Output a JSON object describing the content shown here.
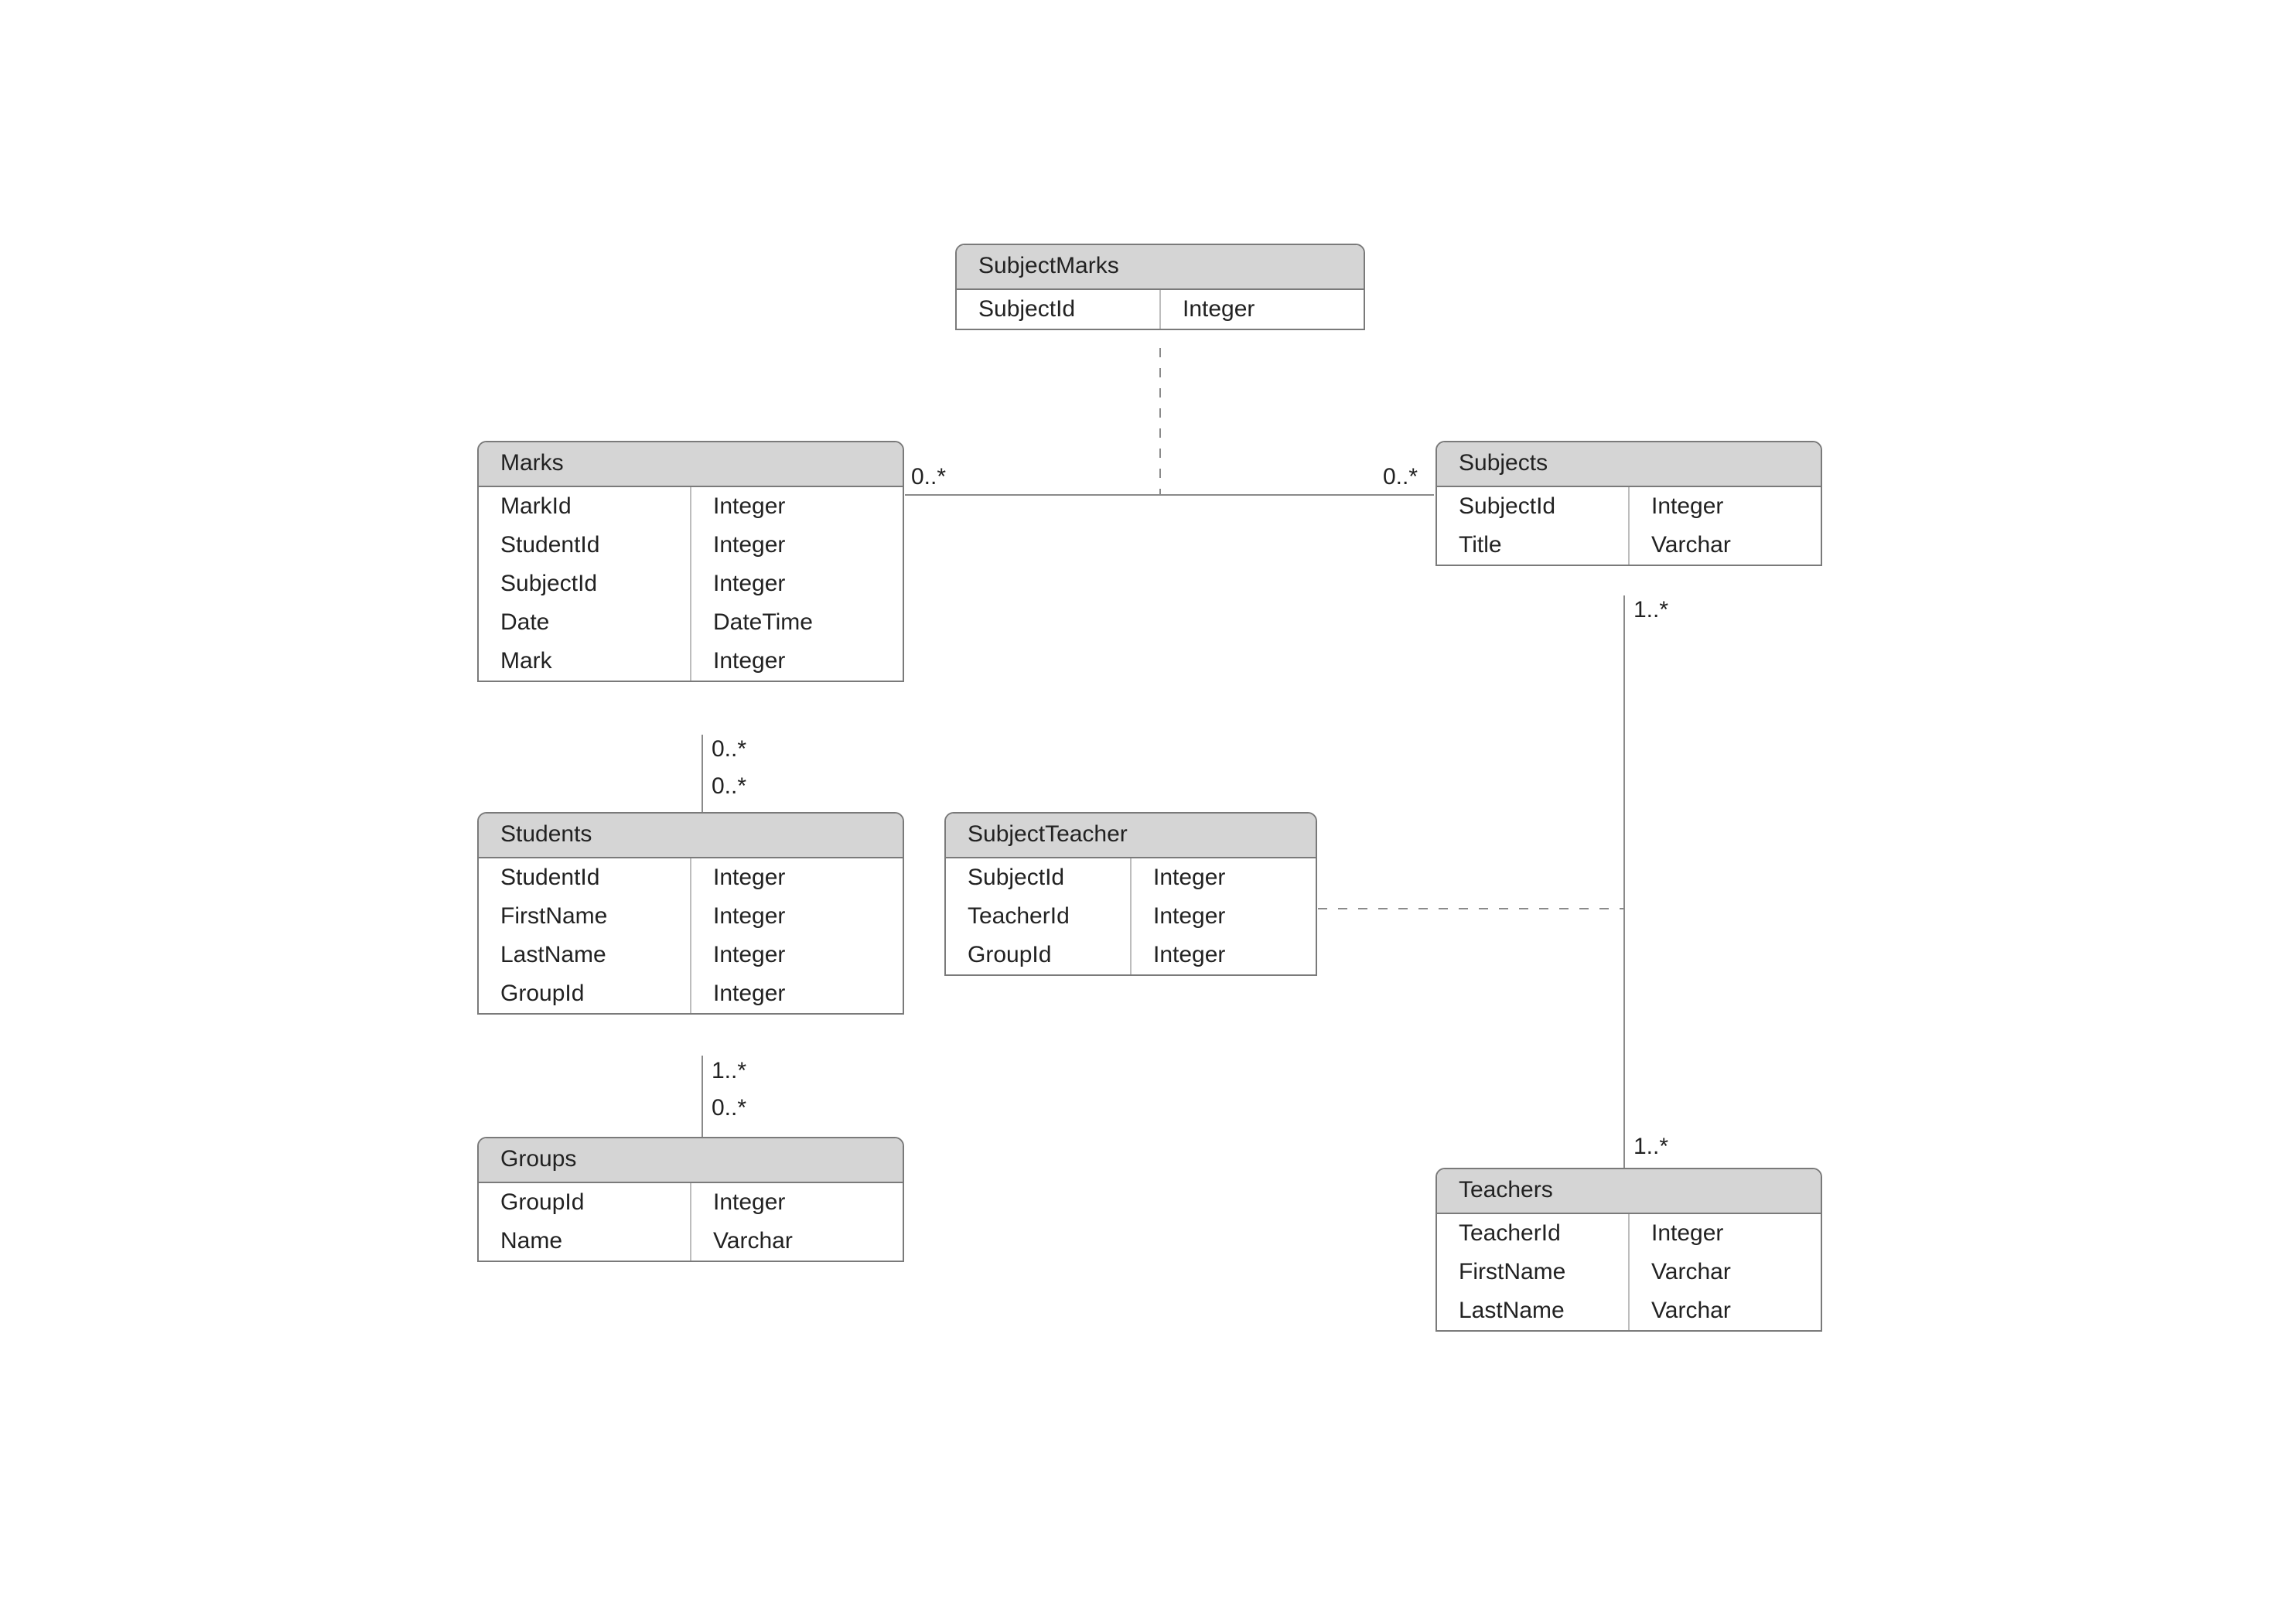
{
  "entities": {
    "subjectMarks": {
      "title": "SubjectMarks",
      "attrs": [
        {
          "name": "SubjectId",
          "type": "Integer"
        }
      ]
    },
    "marks": {
      "title": "Marks",
      "attrs": [
        {
          "name": "MarkId",
          "type": "Integer"
        },
        {
          "name": "StudentId",
          "type": "Integer"
        },
        {
          "name": "SubjectId",
          "type": "Integer"
        },
        {
          "name": "Date",
          "type": "DateTime"
        },
        {
          "name": "Mark",
          "type": "Integer"
        }
      ]
    },
    "subjects": {
      "title": "Subjects",
      "attrs": [
        {
          "name": "SubjectId",
          "type": "Integer"
        },
        {
          "name": "Title",
          "type": "Varchar"
        }
      ]
    },
    "students": {
      "title": "Students",
      "attrs": [
        {
          "name": "StudentId",
          "type": "Integer"
        },
        {
          "name": "FirstName",
          "type": "Integer"
        },
        {
          "name": "LastName",
          "type": "Integer"
        },
        {
          "name": "GroupId",
          "type": "Integer"
        }
      ]
    },
    "subjectTeacher": {
      "title": "SubjectTeacher",
      "attrs": [
        {
          "name": "SubjectId",
          "type": "Integer"
        },
        {
          "name": "TeacherId",
          "type": "Integer"
        },
        {
          "name": "GroupId",
          "type": "Integer"
        }
      ]
    },
    "groups": {
      "title": "Groups",
      "attrs": [
        {
          "name": "GroupId",
          "type": "Integer"
        },
        {
          "name": "Name",
          "type": "Varchar"
        }
      ]
    },
    "teachers": {
      "title": "Teachers",
      "attrs": [
        {
          "name": "TeacherId",
          "type": "Integer"
        },
        {
          "name": "FirstName",
          "type": "Varchar"
        },
        {
          "name": "LastName",
          "type": "Varchar"
        }
      ]
    }
  },
  "multiplicities": {
    "marks_subjects_left": "0..*",
    "marks_subjects_right": "0..*",
    "subjects_teachers_top": "1..*",
    "subjects_teachers_bottom": "1..*",
    "marks_students_top": "0..*",
    "marks_students_bottom": "0..*",
    "students_groups_top": "1..*",
    "students_groups_bottom": "0..*"
  }
}
